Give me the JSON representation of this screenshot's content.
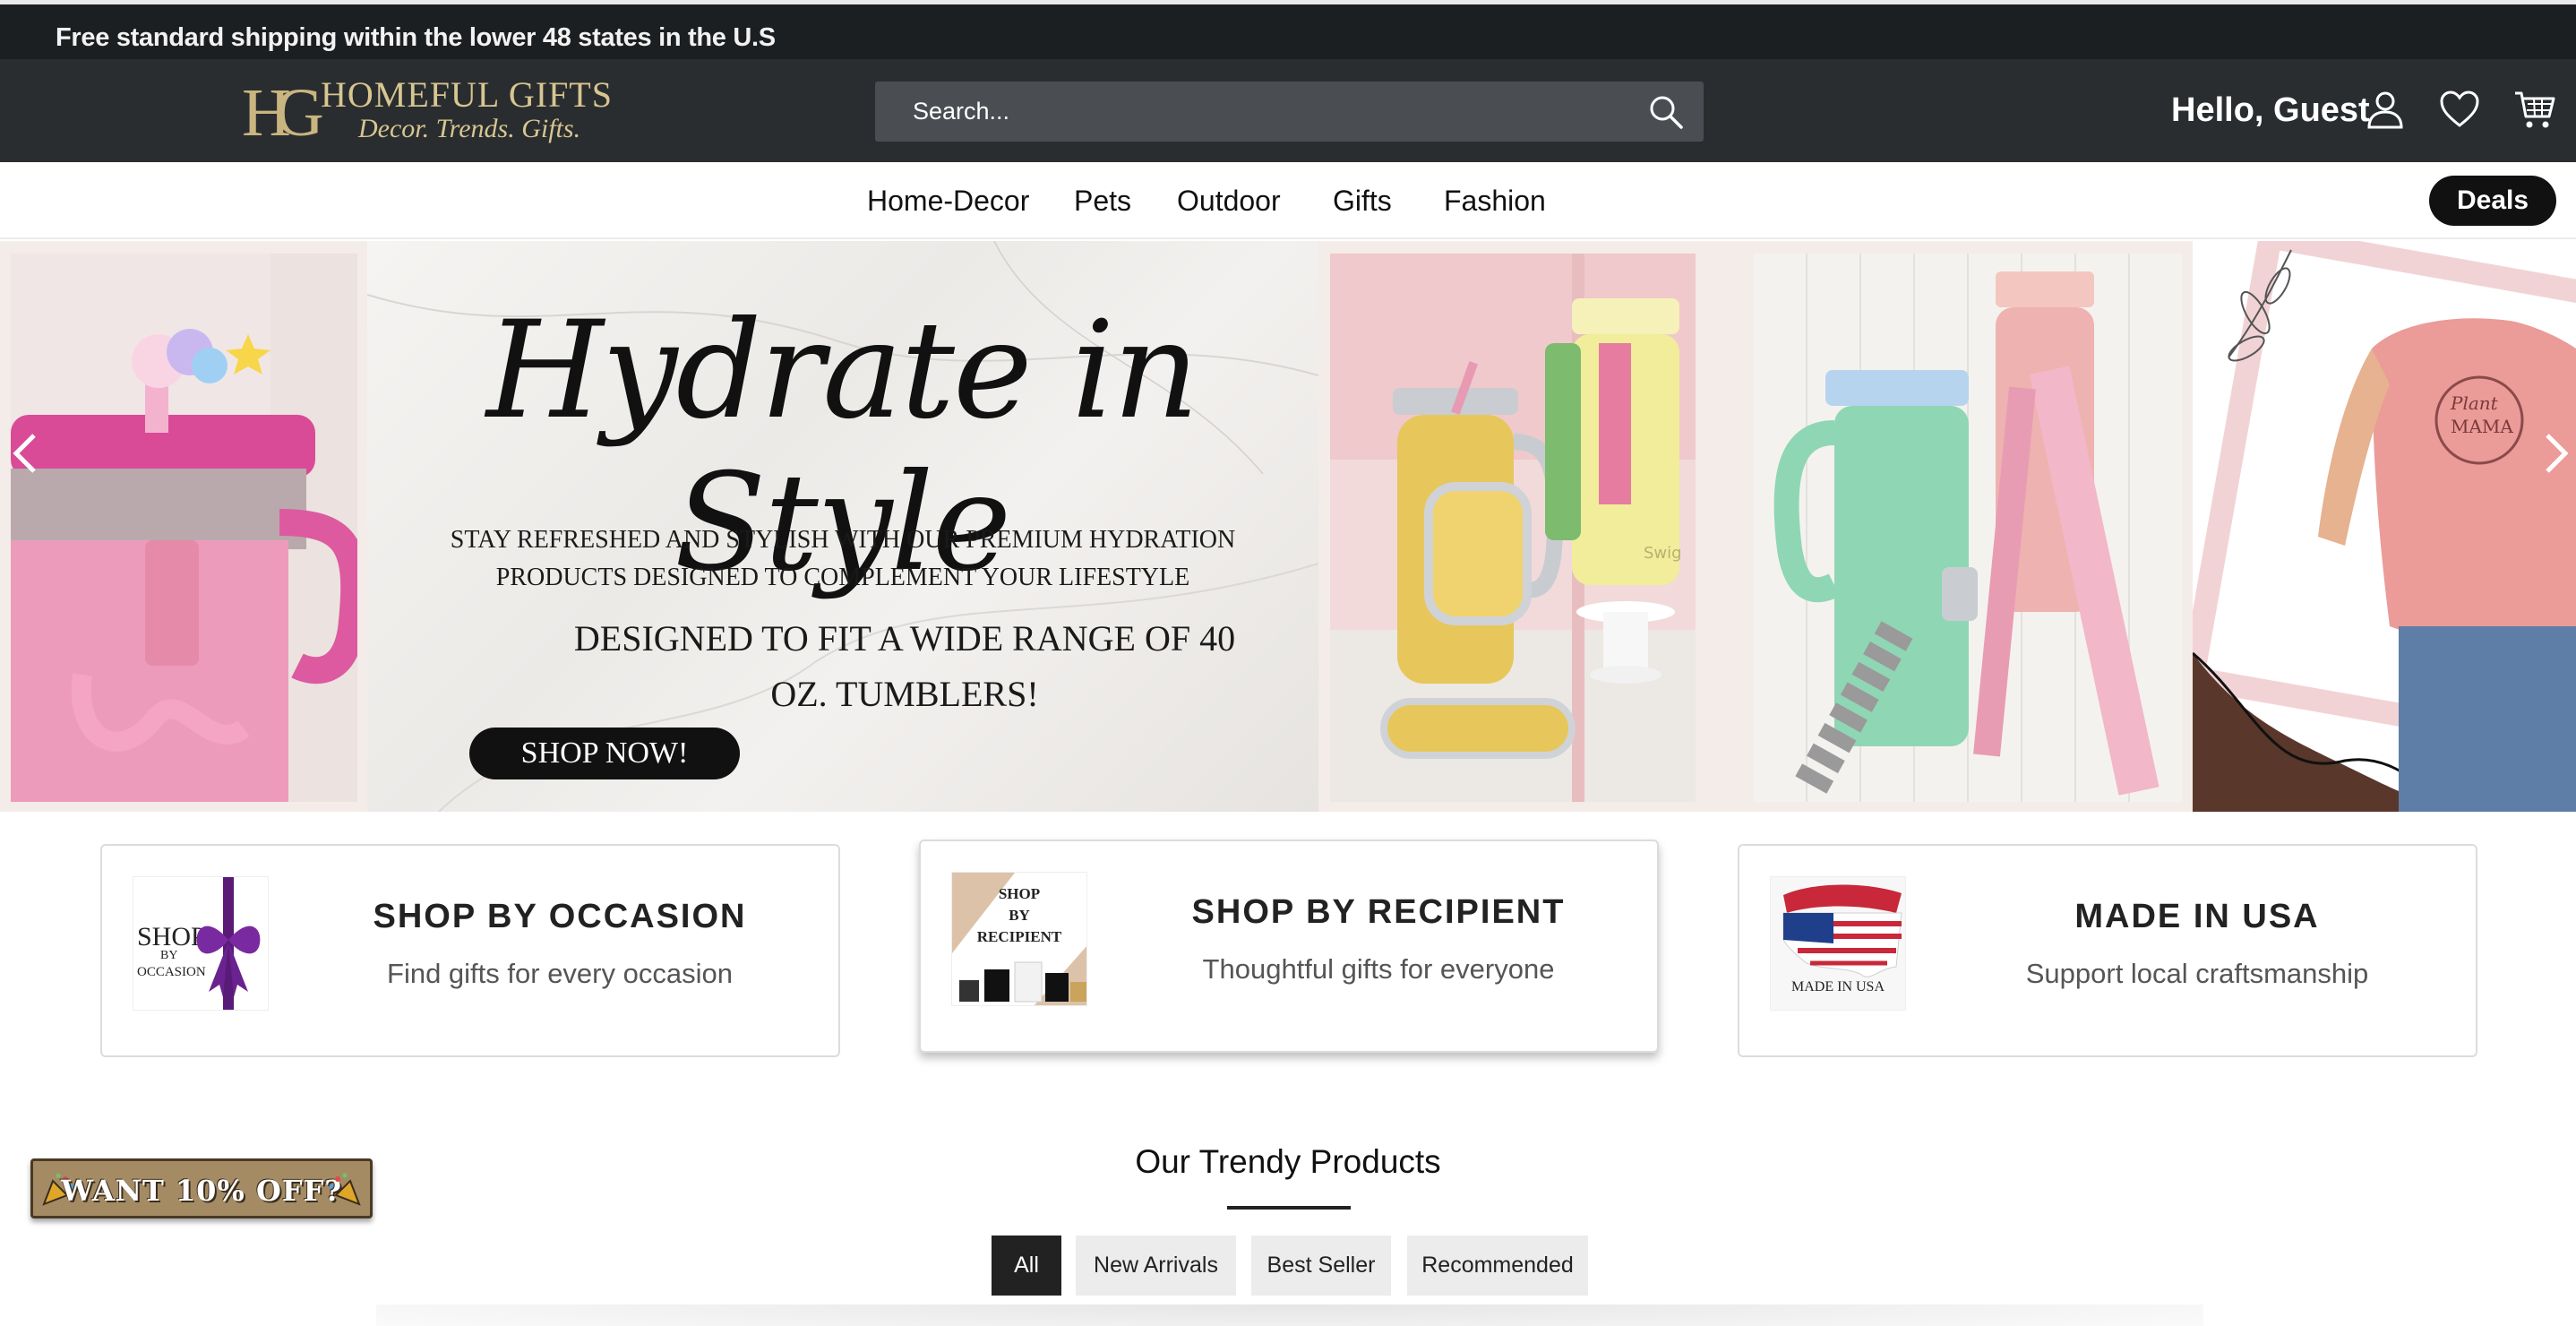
{
  "announcement": {
    "text": "Free standard shipping within the lower 48 states in the U.S"
  },
  "logo": {
    "monogram": "HG",
    "name": "HOMEFUL GIFTS",
    "tagline": "Decor. Trends. Gifts."
  },
  "search": {
    "placeholder": "Search..."
  },
  "header": {
    "greeting": "Hello, Guest",
    "icons": [
      "user-icon",
      "heart-icon",
      "cart-icon"
    ]
  },
  "nav": {
    "items": [
      {
        "label": "Home-Decor"
      },
      {
        "label": "Pets"
      },
      {
        "label": "Outdoor"
      },
      {
        "label": "Gifts"
      },
      {
        "label": "Fashion"
      }
    ],
    "deals_label": "Deals"
  },
  "hero": {
    "headline": "Hydrate in Style",
    "line1": "STAY REFRESHED AND STYLISH WITH OUR PREMIUM HYDRATION",
    "line2": "PRODUCTS DESIGNED TO COMPLEMENT YOUR LIFESTYLE",
    "line3": "DESIGNED TO FIT A WIDE RANGE OF 40",
    "line4": "OZ. TUMBLERS!",
    "cta": "SHOP NOW!",
    "shirt_text_1": "Plant",
    "shirt_text_2": "MAMA",
    "tumbler_brand": "Swig"
  },
  "cards": [
    {
      "title": "SHOP BY OCCASION",
      "subtitle": "Find gifts for every occasion",
      "img_line1": "SHOP",
      "img_line2": "BY",
      "img_line3": "OCCASION"
    },
    {
      "title": "SHOP BY RECIPIENT",
      "subtitle": "Thoughtful gifts for everyone",
      "img_line1": "SHOP",
      "img_line2": "BY",
      "img_line3": "RECIPIENT"
    },
    {
      "title": "MADE IN USA",
      "subtitle": "Support local craftsmanship",
      "img_line1": "MADE IN USA"
    }
  ],
  "trendy": {
    "title": "Our Trendy Products",
    "tabs": [
      {
        "label": "All"
      },
      {
        "label": "New Arrivals"
      },
      {
        "label": "Best Seller"
      },
      {
        "label": "Recommended"
      }
    ]
  },
  "promo": {
    "text": "WANT 10% OFF?"
  },
  "colors": {
    "header_bg": "#2a2d30",
    "announce_bg": "#1c1f21",
    "gold": "#d7c690",
    "accent_pink": "#e58fb0"
  }
}
